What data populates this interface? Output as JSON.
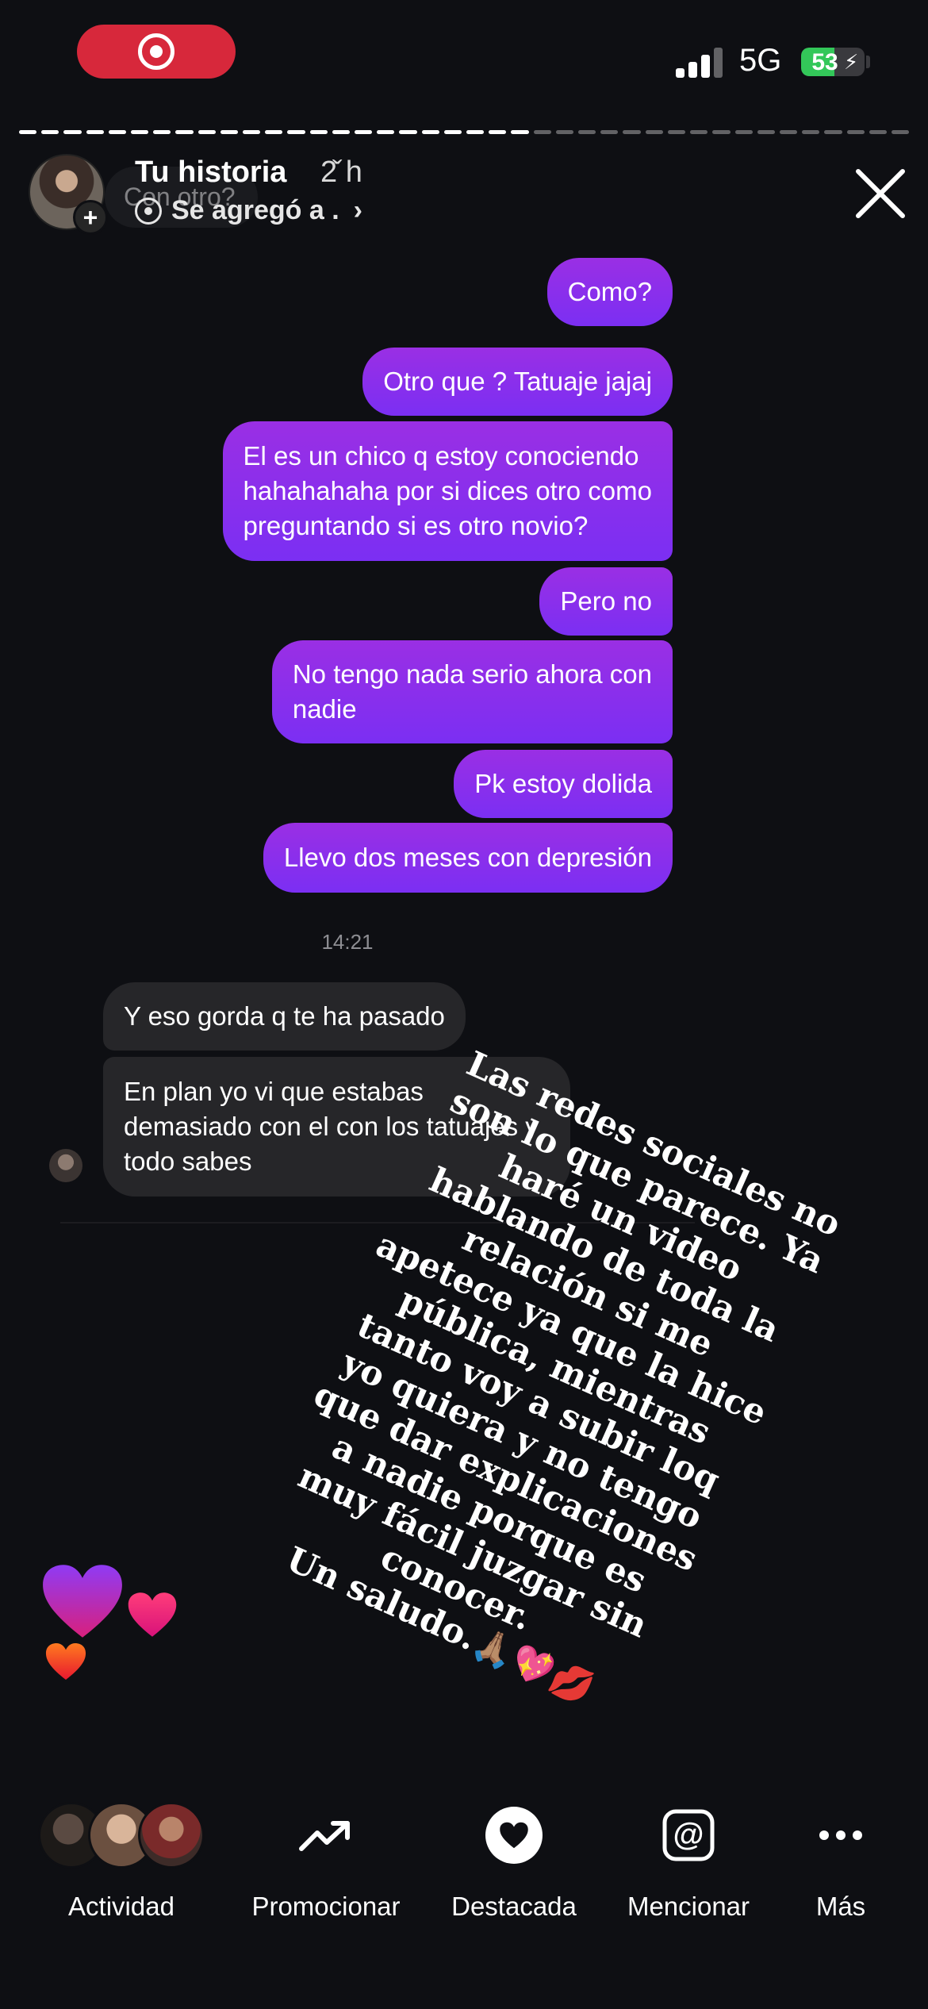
{
  "status_bar": {
    "network": "5G",
    "battery": "53",
    "battery_level": 0.53
  },
  "story": {
    "progress_filled_fraction": 0.58,
    "title": "Tu historia",
    "time": "2̌ h",
    "subtitle": "Se agregó a .",
    "ghost_prompt": "Con otro?"
  },
  "messages": {
    "sent": [
      "Como?",
      "Otro que ? Tatuaje jajaj",
      "El es un chico q estoy conociendo\nhahahahaha por si dices otro como\npreguntando si es otro novio?",
      "Pero no",
      "No tengo nada serio ahora con\nnadie",
      "Pk estoy dolida",
      "Llevo dos meses con depresión"
    ],
    "timestamp": "14:21",
    "received": [
      "Y eso gorda q te ha pasado",
      "En plan yo vi que estabas\ndemasiado con el con los tatuajes y\ntodo sabes"
    ]
  },
  "caption": {
    "text": "Las redes sociales no\nson lo que parece. Ya\nharé un video\nhablando de toda la\nrelación  si me\napetece ya que la hice\npública, mientras\ntanto voy a subir loq\nyo quiera y no tengo\nque dar explicaciones\na nadie porque es\nmuy fácil juzgar sin\nconocer.\nUn saludo.",
    "emojis": "🙏🏽💖💋"
  },
  "colors": {
    "background": "#0e0f13",
    "bubble_sent_top": "#9a2fe4",
    "bubble_sent_bottom": "#7b2ff3",
    "bubble_received": "#262629",
    "record_pill": "#d7283b",
    "battery_green": "#33c759"
  },
  "bottom_bar": {
    "items": [
      {
        "label": "Actividad",
        "icon": "activity-avatars"
      },
      {
        "label": "Promocionar",
        "icon": "trending-up-icon"
      },
      {
        "label": "Destacada",
        "icon": "heart-circle-icon"
      },
      {
        "label": "Mencionar",
        "icon": "at-sign-icon"
      },
      {
        "label": "Más",
        "icon": "more-dots-icon"
      }
    ]
  }
}
